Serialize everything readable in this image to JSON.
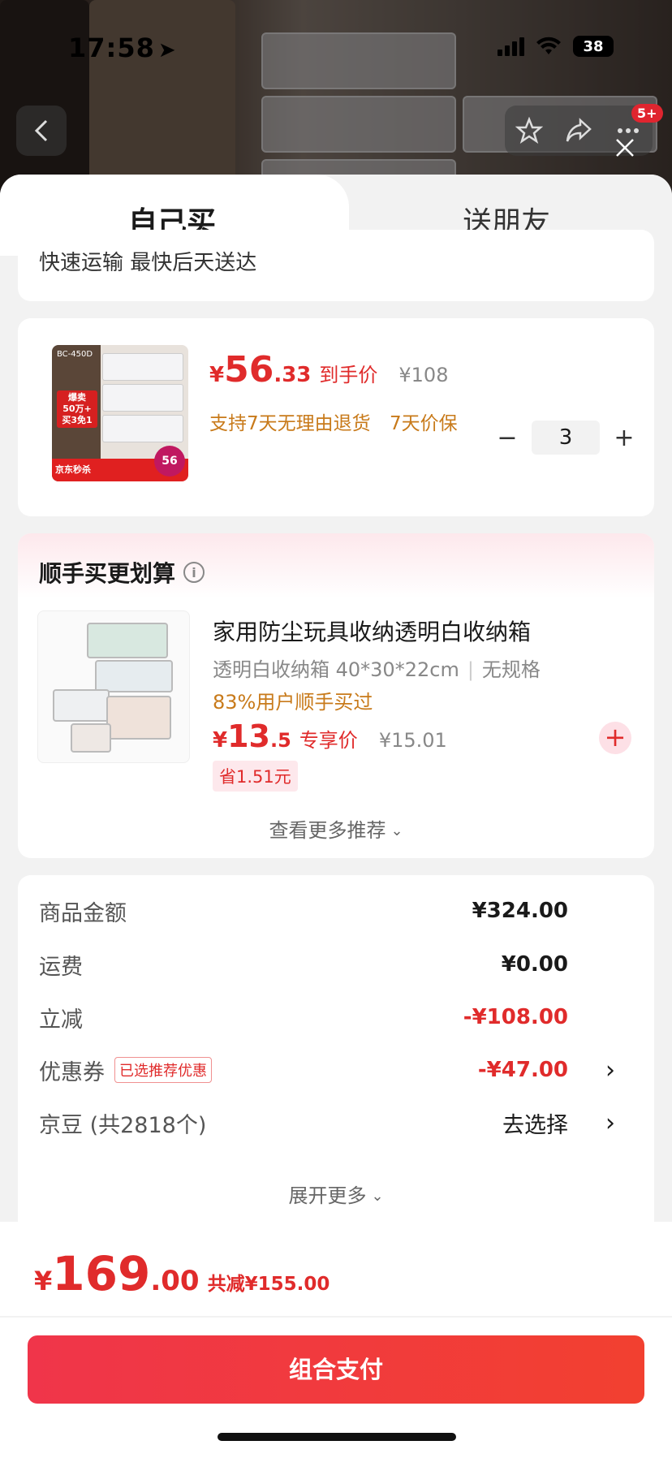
{
  "status_bar": {
    "time": "17:58",
    "battery": "38"
  },
  "top_nav": {
    "badge": "5+"
  },
  "tabs": {
    "self": "自己买",
    "friend": "送朋友"
  },
  "delivery": {
    "text": "快速运输 最快后天送达"
  },
  "product": {
    "img_top_label": "BC-450D",
    "img_badge_lines": [
      "爆卖",
      "50万+",
      "买3免1"
    ],
    "img_bottom_left": "京东秒杀",
    "img_price_badge": "56",
    "yen": "¥",
    "price_int": "56",
    "price_dec": ".33",
    "price_tag": "到手价",
    "orig_price": "¥108",
    "services": [
      "支持7天无理由退货",
      "7天价保"
    ],
    "qty": "3",
    "minus": "−",
    "plus": "+"
  },
  "addon": {
    "title": "顺手买更划算",
    "info": "i",
    "name": "家用防尘玩具收纳透明白收纳箱",
    "spec": "透明白收纳箱 40*30*22cm",
    "spec2": "无规格",
    "bought": "83%用户顺手买过",
    "yen": "¥",
    "price_int": "13",
    "price_dec": ".5",
    "price_tag": "专享价",
    "orig_price": "¥15.01",
    "save": "省1.51元",
    "add": "+",
    "see_more": "查看更多推荐"
  },
  "summary": {
    "rows": [
      {
        "label": "商品金额",
        "value": "¥324.00"
      },
      {
        "label": "运费",
        "value": "¥0.00"
      },
      {
        "label": "立减",
        "value": "-¥108.00"
      },
      {
        "label": "优惠券",
        "tag": "已选推荐优惠",
        "value": "-¥47.00"
      },
      {
        "label": "京豆 (共2818个)",
        "value": "去选择"
      }
    ],
    "expand": "展开更多"
  },
  "footer": {
    "yen": "¥",
    "total_int": "169",
    "total_dec": ".00",
    "discount": "共减¥155.00",
    "pay_button": "组合支付"
  },
  "colors": {
    "accent": "#e02b2b",
    "service": "#c87a1a",
    "pay_start": "#f0354a",
    "pay_end": "#f24030"
  }
}
